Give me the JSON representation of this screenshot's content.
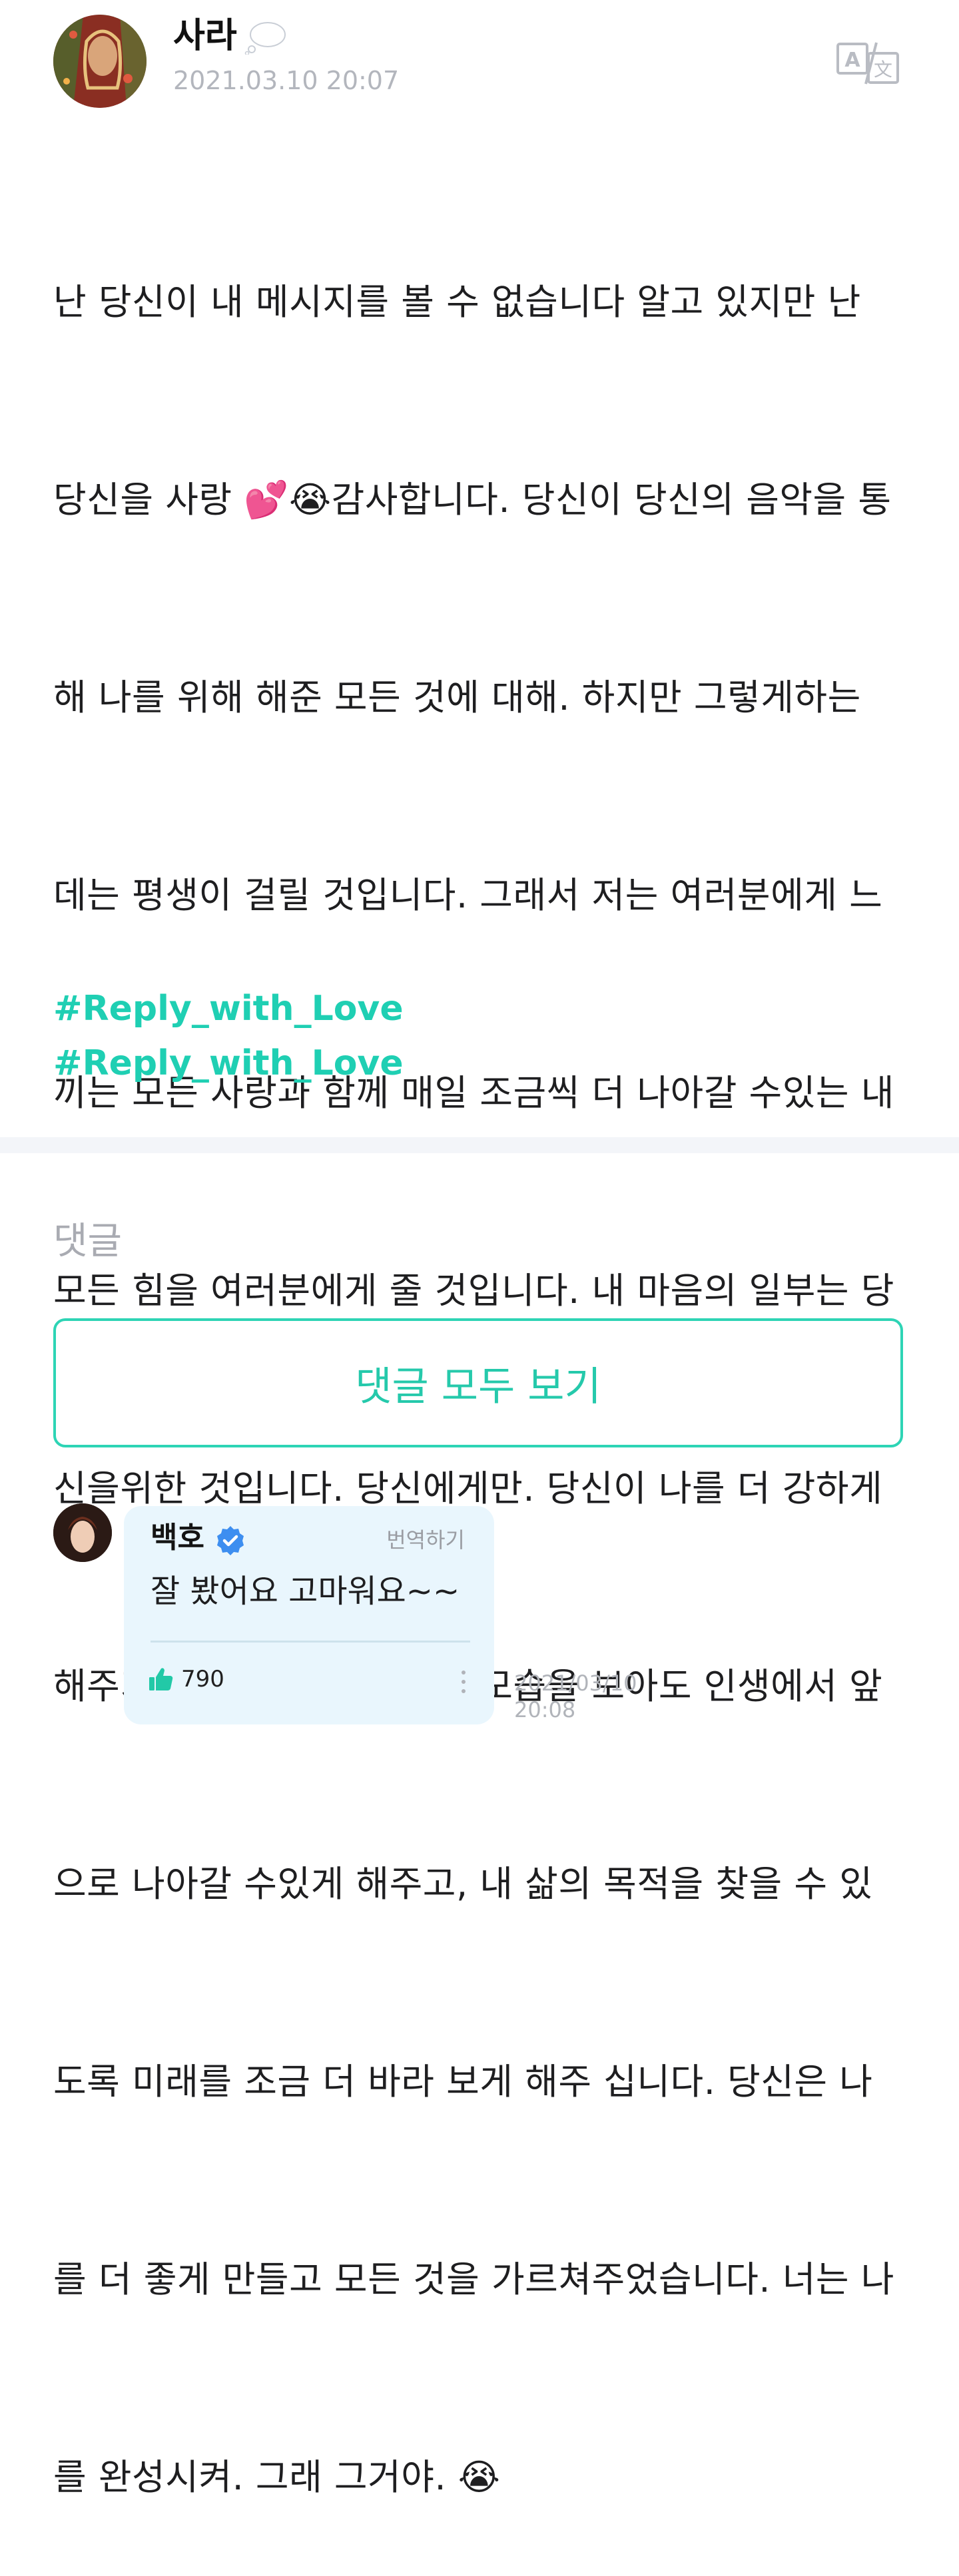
{
  "post": {
    "author": "사라",
    "date": "2021.03.10 20:07",
    "body_lines": [
      "난 당신이 내 메시지를 볼 수 없습니다 알고 있지만 난",
      "당신을 사랑 💕😭감사합니다. 당신이 당신의 음악을 통",
      "해 나를 위해 해준 모든 것에 대해. 하지만 그렇게하는",
      "데는 평생이 걸릴 것입니다. 그래서 저는 여러분에게 느",
      "끼는 모든 사랑과 함께 매일 조금씩 더 나아갈 수있는 내",
      "모든 힘을 여러분에게 줄 것입니다. 내 마음의 일부는 당",
      "신을위한 것입니다. 당신에게만. 당신이 나를 더 강하게",
      "해주기 때문에, 당신이 웃는 모습을 보아도 인생에서 앞",
      "으로 나아갈 수있게 해주고, 내 삶의 목적을 찾을 수 있",
      "도록 미래를 조금 더 바라 보게 해주 십니다. 당신은 나",
      "를 더 좋게 만들고 모든 것을 가르쳐주었습니다. 너는 나",
      "를 완성시켜. 그래 그거야. 😭"
    ],
    "hashtags": [
      "#Reply_with_Love",
      "#Reply_with_Love"
    ],
    "icons": {
      "author_status": "thought-bubble-icon",
      "translate": "translate-icon"
    }
  },
  "comments": {
    "title": "댓글",
    "view_all_label": "댓글 모두 보기",
    "items": [
      {
        "name": "백호",
        "verified": true,
        "translate_label": "번역하기",
        "text": "잘 봤어요 고마워요~~",
        "likes": "790",
        "date_line1": "2021/03/10",
        "date_line2": "20:08"
      }
    ]
  },
  "colors": {
    "accent": "#2dd4b5",
    "hashtag": "#1fcfb3",
    "bubble": "#e9f6fd",
    "muted": "#b3b6bd",
    "verified": "#3d8ef0"
  }
}
